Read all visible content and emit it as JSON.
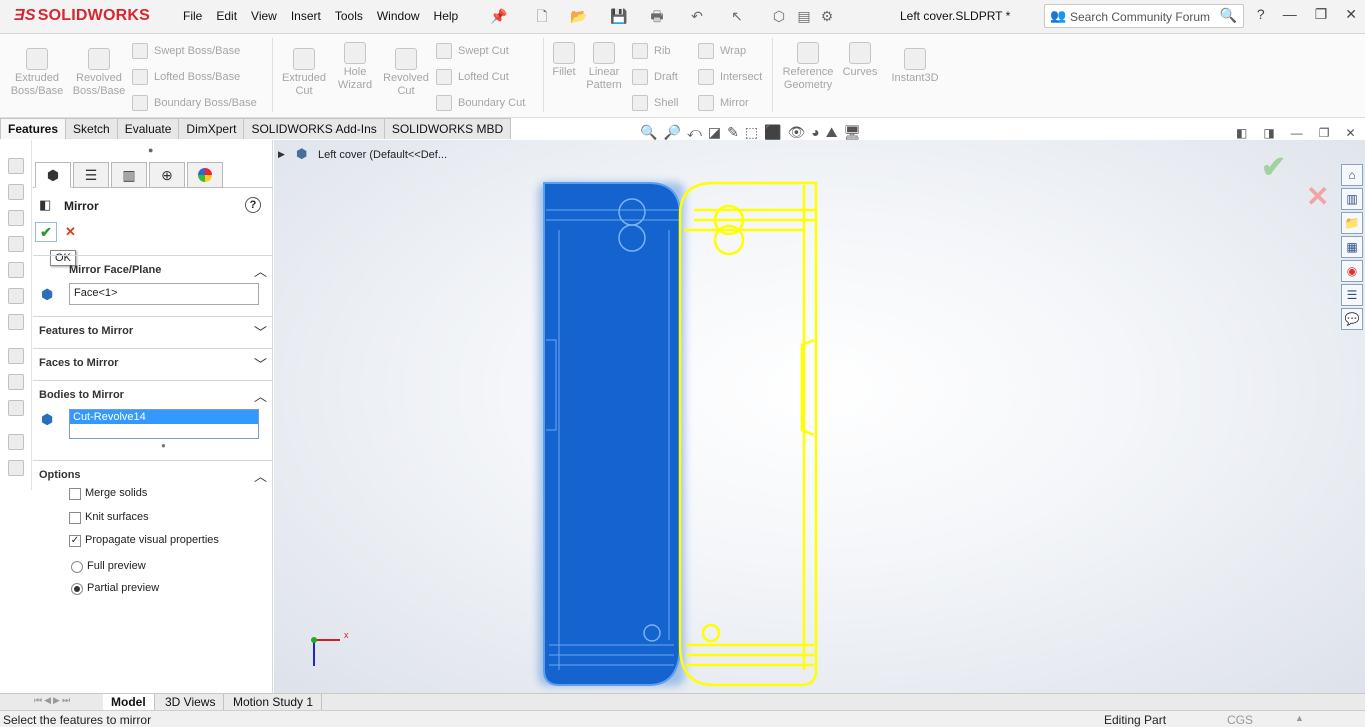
{
  "app": {
    "logo": "SOLIDWORKS",
    "doc_title": "Left cover.SLDPRT *"
  },
  "menu": [
    "File",
    "Edit",
    "View",
    "Insert",
    "Tools",
    "Window",
    "Help"
  ],
  "search": {
    "placeholder": "Search Community Forum"
  },
  "commands": {
    "extruded_boss": "Extruded Boss/Base",
    "revolved_boss": "Revolved Boss/Base",
    "swept_boss": "Swept Boss/Base",
    "lofted_boss": "Lofted Boss/Base",
    "boundary_boss": "Boundary Boss/Base",
    "extruded_cut": "Extruded Cut",
    "hole_wizard": "Hole Wizard",
    "revolved_cut": "Revolved Cut",
    "swept_cut": "Swept Cut",
    "lofted_cut": "Lofted Cut",
    "boundary_cut": "Boundary Cut",
    "fillet": "Fillet",
    "linear_pattern": "Linear Pattern",
    "rib": "Rib",
    "draft": "Draft",
    "shell": "Shell",
    "wrap": "Wrap",
    "intersect": "Intersect",
    "mirror": "Mirror",
    "reference_geometry": "Reference Geometry",
    "curves": "Curves",
    "instant3d": "Instant3D"
  },
  "tabs": [
    "Features",
    "Sketch",
    "Evaluate",
    "DimXpert",
    "SOLIDWORKS Add-Ins",
    "SOLIDWORKS MBD"
  ],
  "pm": {
    "title": "Mirror",
    "ok_tooltip": "OK",
    "mirror_face_plane": {
      "label": "Mirror Face/Plane",
      "value": "Face<1>"
    },
    "features_to_mirror": "Features to Mirror",
    "faces_to_mirror": "Faces to Mirror",
    "bodies_to_mirror": {
      "label": "Bodies to Mirror",
      "value": "Cut-Revolve14"
    },
    "options": {
      "label": "Options",
      "merge_solids": {
        "label": "Merge solids",
        "checked": false
      },
      "knit_surfaces": {
        "label": "Knit surfaces",
        "checked": false
      },
      "propagate": {
        "label": "Propagate visual properties",
        "checked": true
      },
      "full_preview": {
        "label": "Full preview",
        "selected": false
      },
      "partial_preview": {
        "label": "Partial preview",
        "selected": true
      }
    }
  },
  "tree": {
    "node": "Left cover  (Default<<Def..."
  },
  "bottom_tabs": [
    "Model",
    "3D Views",
    "Motion Study 1"
  ],
  "status": {
    "left": "Select the features to mirror",
    "mode": "Editing Part",
    "units": "CGS"
  },
  "colors": {
    "body": "#1d6bd2",
    "preview": "#ffff00",
    "logo": "#d7262f"
  }
}
